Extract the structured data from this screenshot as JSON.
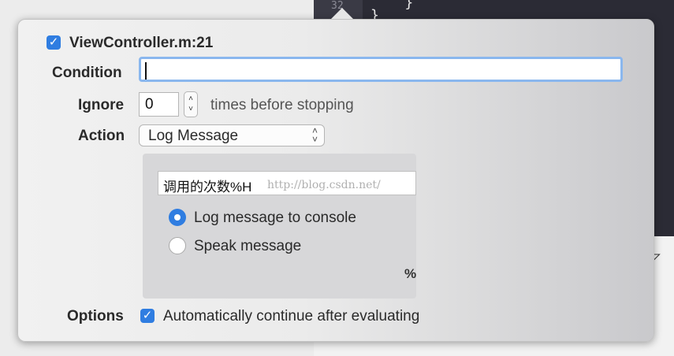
{
  "editor": {
    "line_number": "32",
    "code_line": "    }\n}"
  },
  "breakpoint": {
    "enabled": true,
    "title": "ViewController.m:21"
  },
  "condition": {
    "label": "Condition",
    "value": ""
  },
  "ignore": {
    "label": "Ignore",
    "value": "0",
    "suffix": "times before stopping"
  },
  "action": {
    "label": "Action",
    "selected": "Log Message",
    "message": "调用的次数%H",
    "watermark": "http://blog.csdn.net/",
    "options": [
      {
        "label": "Log message to console",
        "selected": true
      },
      {
        "label": "Speak message",
        "selected": false
      }
    ],
    "percent_button": "%"
  },
  "options": {
    "label": "Options",
    "auto_continue": true,
    "auto_continue_label": "Automatically continue after evaluating"
  },
  "colors": {
    "accent": "#2f7de1",
    "focus_ring": "#8ab7ee",
    "editor_bg": "#2b2b35"
  }
}
